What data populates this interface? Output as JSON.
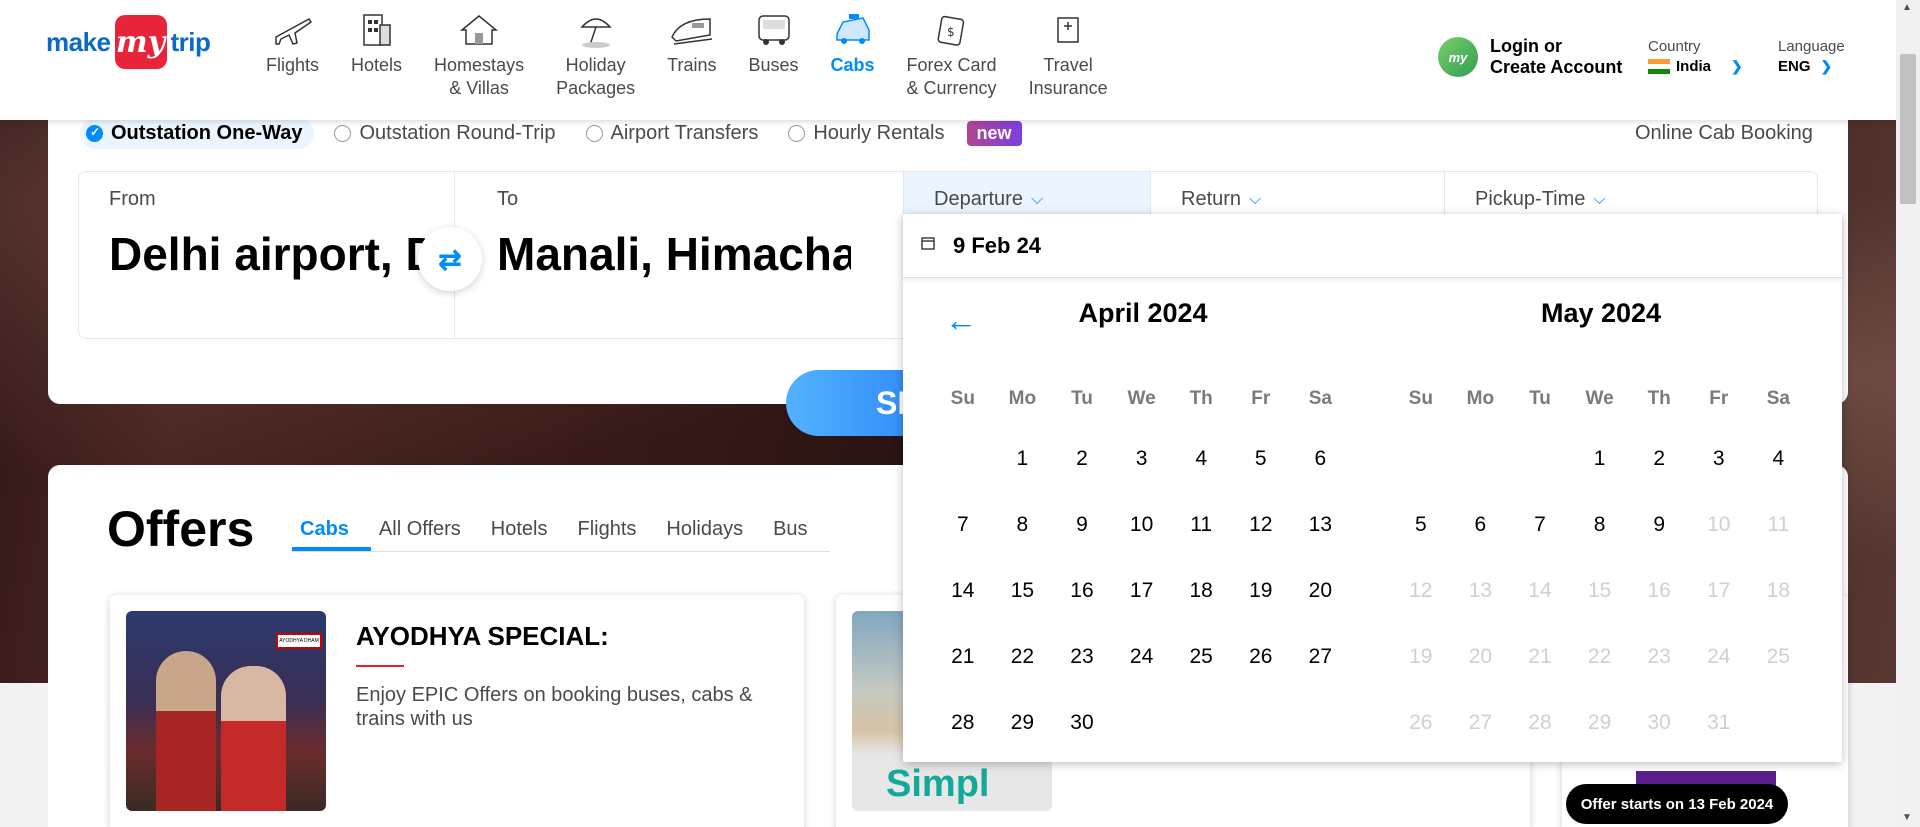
{
  "brand": {
    "left": "make",
    "mid": "my",
    "right": "trip"
  },
  "nav": [
    {
      "label": "Flights",
      "icon": "plane-icon"
    },
    {
      "label": "Hotels",
      "icon": "hotel-icon"
    },
    {
      "label": "Homestays\n& Villas",
      "icon": "homestay-icon"
    },
    {
      "label": "Holiday\nPackages",
      "icon": "umbrella-icon"
    },
    {
      "label": "Trains",
      "icon": "train-icon"
    },
    {
      "label": "Buses",
      "icon": "bus-icon"
    },
    {
      "label": "Cabs",
      "icon": "cab-icon",
      "active": true
    },
    {
      "label": "Forex Card\n& Currency",
      "icon": "forex-icon"
    },
    {
      "label": "Travel\nInsurance",
      "icon": "insurance-icon"
    }
  ],
  "account": {
    "avatar": "my",
    "line1": "Login or",
    "line2": "Create Account"
  },
  "country": {
    "title": "Country",
    "value": "India"
  },
  "language": {
    "title": "Language",
    "value": "ENG"
  },
  "trip_types": [
    {
      "label": "Outstation One-Way",
      "selected": true
    },
    {
      "label": "Outstation Round-Trip"
    },
    {
      "label": "Airport Transfers"
    },
    {
      "label": "Hourly Rentals"
    }
  ],
  "new_badge": "new",
  "online_label": "Online Cab Booking",
  "fields": {
    "from": {
      "caption": "From",
      "value": "Delhi airport, Delhi"
    },
    "to": {
      "caption": "To",
      "value": "Manali, Himachal Pradesh"
    },
    "departure": {
      "caption": "Departure"
    },
    "return": {
      "caption": "Return"
    },
    "pickup": {
      "caption": "Pickup-Time"
    }
  },
  "search_label": "SEARCH",
  "offers": {
    "title": "Offers",
    "tabs": [
      "Cabs",
      "All Offers",
      "Hotels",
      "Flights",
      "Holidays",
      "Bus"
    ],
    "card1": {
      "title": "AYODHYA SPECIAL:",
      "text": "Enjoy EPIC Offers on booking buses, cabs & trains with us",
      "sign": "AYODHYA DHAM"
    },
    "card2": {
      "brand": "Simpl"
    },
    "card3_badge": "Offer starts on 13 Feb 2024"
  },
  "calendar": {
    "input_value": "9 Feb 24",
    "weekdays": [
      "Su",
      "Mo",
      "Tu",
      "We",
      "Th",
      "Fr",
      "Sa"
    ],
    "months": [
      {
        "name": "April 2024",
        "lead_blanks": 1,
        "days": 30,
        "disabled_from": 31
      },
      {
        "name": "May 2024",
        "lead_blanks": 3,
        "days": 31,
        "disabled_from": 10
      }
    ]
  },
  "colors": {
    "accent": "#008cff",
    "brand_red": "#e8243a",
    "brand_blue": "#0c6ac6"
  }
}
